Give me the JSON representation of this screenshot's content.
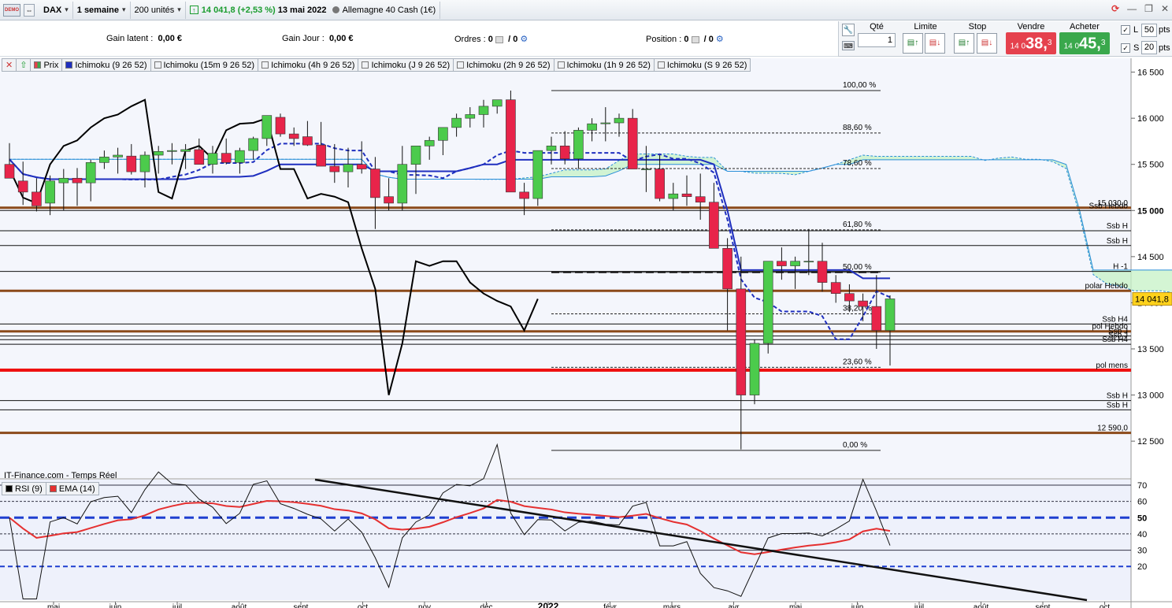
{
  "toolbar": {
    "demo_label": "DEMO",
    "instrument": "DAX",
    "period": "1 semaine",
    "units": "200 unités",
    "price": "14 041,8",
    "change": "(+2,53 %)",
    "date": "13 mai 2022",
    "market": "Allemagne 40 Cash (1€)"
  },
  "info": {
    "gain_latent_label": "Gain latent :",
    "gain_latent_value": "0,00 €",
    "gain_jour_label": "Gain Jour :",
    "gain_jour_value": "0,00 €",
    "ordres_label": "Ordres :",
    "ordres_a": "0",
    "ordres_b": "/ 0",
    "position_label": "Position :",
    "position_a": "0",
    "position_b": "/ 0"
  },
  "order": {
    "qte_label": "Qté",
    "qte_value": "1",
    "limite_label": "Limite",
    "stop_label": "Stop",
    "vendre_label": "Vendre",
    "acheter_label": "Acheter",
    "vendre_prefix": "14 0",
    "vendre_big": "38,",
    "vendre_sup": "3",
    "acheter_prefix": "14 0",
    "acheter_big": "45,",
    "acheter_sup": "3",
    "l_label": "L",
    "l_pts": "50",
    "s_label": "S",
    "s_pts": "20",
    "pts_label": "pts",
    "sell_color": "#e5414d",
    "buy_color": "#3aa84c"
  },
  "legend": [
    "Prix",
    "Ichimoku (9 26 52)",
    "Ichimoku (15m 9 26 52)",
    "Ichimoku (4h 9 26 52)",
    "Ichimoku (J 9 26 52)",
    "Ichimoku (2h 9 26 52)",
    "Ichimoku (1h 9 26 52)",
    "Ichimoku (S 9 26 52)"
  ],
  "watermark": "IT-Finance.com - Temps Réel",
  "rsi_legend": [
    "RSI (9)",
    "EMA (14)"
  ],
  "chart_data": {
    "type": "candlestick",
    "y_axis": [
      "16 500",
      "16 000",
      "15 500",
      "15 000",
      "14 500",
      "14 000",
      "13 500",
      "13 000",
      "12 500"
    ],
    "x_axis": [
      "mai",
      "juin",
      "juil",
      "août",
      "sept",
      "oct",
      "nov",
      "déc",
      "2022",
      "févr",
      "mars",
      "avr",
      "mai",
      "juin",
      "juil",
      "août",
      "sept",
      "oct"
    ],
    "ylim": [
      12100,
      16650
    ],
    "last_price": "14 041,8",
    "fibonacci": [
      {
        "label": "100,00 %",
        "y": 16300
      },
      {
        "label": "88,60 %",
        "y": 15840
      },
      {
        "label": "78,60 %",
        "y": 15455
      },
      {
        "label": "61,80 %",
        "y": 14790
      },
      {
        "label": "50,00 %",
        "y": 14330
      },
      {
        "label": "38,20 %",
        "y": 13880
      },
      {
        "label": "23,60 %",
        "y": 13300
      },
      {
        "label": "0,00 %",
        "y": 12400
      }
    ],
    "levels": [
      {
        "label": "15 030,0",
        "y": 15030
      },
      {
        "label": "Ssb Hebdo",
        "y": 15000
      },
      {
        "label": "Ssb H",
        "y": 14780
      },
      {
        "label": "Ssb H",
        "y": 14620
      },
      {
        "label": "H -1",
        "y": 14340
      },
      {
        "label": "polar Hebdo",
        "y": 14130
      },
      {
        "label": "Ssb H4",
        "y": 13770
      },
      {
        "label": "pol Hebdo",
        "y": 13690
      },
      {
        "label": "Ssb J",
        "y": 13640
      },
      {
        "label": "Ssb J",
        "y": 13600
      },
      {
        "label": "Ssb H4",
        "y": 13550
      },
      {
        "label": "pol mens",
        "y": 13270
      },
      {
        "label": "Ssb H",
        "y": 12940
      },
      {
        "label": "Ssb H",
        "y": 12840
      },
      {
        "label": "12 590,0",
        "y": 12590
      }
    ],
    "candles": [
      [
        15500,
        15730,
        15380,
        15350
      ],
      [
        15320,
        15530,
        15060,
        15200
      ],
      [
        15200,
        15350,
        14990,
        15050
      ],
      [
        15080,
        15380,
        14950,
        15320
      ],
      [
        15300,
        15450,
        15000,
        15350
      ],
      [
        15350,
        15460,
        15050,
        15300
      ],
      [
        15300,
        15550,
        15100,
        15520
      ],
      [
        15520,
        15650,
        15450,
        15580
      ],
      [
        15580,
        15680,
        15400,
        15600
      ],
      [
        15590,
        15720,
        15390,
        15420
      ],
      [
        15420,
        15640,
        15250,
        15600
      ],
      [
        15600,
        15700,
        15400,
        15640
      ],
      [
        15640,
        15730,
        15500,
        15650
      ],
      [
        15640,
        15720,
        15450,
        15660
      ],
      [
        15660,
        15780,
        15500,
        15500
      ],
      [
        15500,
        15700,
        15400,
        15620
      ],
      [
        15620,
        15780,
        15500,
        15520
      ],
      [
        15520,
        15680,
        15400,
        15650
      ],
      [
        15650,
        15800,
        15550,
        15780
      ],
      [
        15780,
        15910,
        15700,
        16030
      ],
      [
        16010,
        16050,
        15800,
        15830
      ],
      [
        15830,
        15900,
        15700,
        15780
      ],
      [
        15800,
        15970,
        15700,
        15710
      ],
      [
        15710,
        15960,
        15600,
        15480
      ],
      [
        15480,
        15720,
        15300,
        15420
      ],
      [
        15420,
        15680,
        15250,
        15500
      ],
      [
        15500,
        15750,
        15400,
        15450
      ],
      [
        15450,
        15580,
        14800,
        15140
      ],
      [
        15150,
        15350,
        15000,
        15080
      ],
      [
        15080,
        15700,
        15000,
        15500
      ],
      [
        15500,
        15600,
        15180,
        15700
      ],
      [
        15700,
        15800,
        15550,
        15760
      ],
      [
        15760,
        15900,
        15600,
        15900
      ],
      [
        15900,
        16050,
        15800,
        16000
      ],
      [
        16000,
        16120,
        15900,
        16040
      ],
      [
        16040,
        16200,
        15900,
        16130
      ],
      [
        16130,
        16200,
        16050,
        16200
      ],
      [
        16200,
        16300,
        16000,
        15200
      ],
      [
        15200,
        15300,
        14950,
        15130
      ],
      [
        15130,
        15650,
        15050,
        15650
      ],
      [
        15650,
        15800,
        15500,
        15700
      ],
      [
        15700,
        15860,
        15500,
        15560
      ],
      [
        15560,
        15900,
        15450,
        15870
      ],
      [
        15870,
        16000,
        15750,
        15940
      ],
      [
        15940,
        16120,
        15750,
        15950
      ],
      [
        15950,
        16050,
        15800,
        16000
      ],
      [
        16000,
        16100,
        15550,
        15450
      ],
      [
        15450,
        15700,
        15200,
        15450
      ],
      [
        15450,
        15600,
        15100,
        15130
      ],
      [
        15130,
        15300,
        15000,
        15180
      ],
      [
        15180,
        15380,
        15050,
        15150
      ],
      [
        15150,
        15400,
        14900,
        15090
      ],
      [
        15090,
        15300,
        14700,
        14590
      ],
      [
        14590,
        14700,
        13700,
        14150
      ],
      [
        14150,
        14500,
        12410,
        13000
      ],
      [
        13000,
        13600,
        12900,
        13560
      ],
      [
        13560,
        14450,
        13450,
        14450
      ],
      [
        14450,
        14600,
        14250,
        14400
      ],
      [
        14400,
        14500,
        14150,
        14450
      ],
      [
        14450,
        14800,
        14300,
        14450
      ],
      [
        14450,
        14650,
        14120,
        14220
      ],
      [
        14220,
        14300,
        14000,
        14100
      ],
      [
        14100,
        14200,
        13900,
        14020
      ],
      [
        14020,
        14100,
        13800,
        13960
      ],
      [
        13960,
        14300,
        13500,
        13700
      ],
      [
        13700,
        14080,
        13320,
        14042
      ]
    ],
    "rsi": {
      "levels": [
        70,
        60,
        50,
        40,
        30,
        20
      ],
      "last": 41
    }
  }
}
